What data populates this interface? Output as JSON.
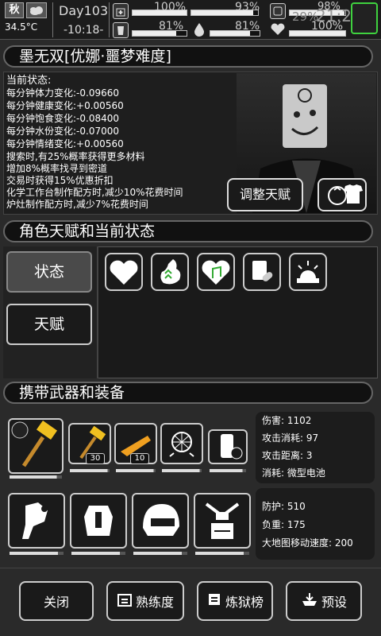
{
  "status_bar": {
    "season": "秋",
    "temperature": "34.5°C",
    "day": "Day103",
    "time": "-10:18-",
    "stats": [
      {
        "name": "stamina",
        "value": "100%",
        "level": 1.0
      },
      {
        "name": "mood",
        "value": "93%",
        "level": 0.93
      },
      {
        "name": "health",
        "value": "98%",
        "level": 0.98
      },
      {
        "name": "hunger",
        "value": "81%",
        "level": 0.81
      },
      {
        "name": "water",
        "value": "81%",
        "level": 0.81
      },
      {
        "name": "heart",
        "value": "100%",
        "level": 1.0
      }
    ],
    "battery": "29%",
    "clock": "21:21"
  },
  "character": {
    "name": "墨无双[优娜·噩梦难度]",
    "status_title": "当前状态:",
    "status_lines": [
      "每分钟体力变化:-0.09660",
      "每分钟健康变化:+0.00560",
      "每分钟饱食变化:-0.08400",
      "每分钟水份变化:-0.07000",
      "每分钟情绪变化:+0.00560",
      "搜索时,有25%概率获得更多材料",
      "增加8%概率找寻到密道",
      "交易时获得15%优惠折扣",
      "化学工作台制作配方时,减少10%花费时间",
      "炉灶制作配方时,减少7%花费时间"
    ],
    "adjust_talent_button": "调整天赋"
  },
  "talents": {
    "header": "角色天赋和当前状态",
    "tabs": [
      "状态",
      "天赋"
    ]
  },
  "equipment": {
    "header": "携带武器和装备",
    "weapon_slots": [
      {
        "name": "hammer-main",
        "count": "",
        "durability": 0.9
      },
      {
        "name": "hammer-2",
        "count": "30",
        "durability": 0.95
      },
      {
        "name": "rifle",
        "count": "10",
        "durability": 0.95
      },
      {
        "name": "disco-mine",
        "count": "",
        "durability": 0.95
      },
      {
        "name": "battery",
        "count": "",
        "durability": 0.9
      }
    ],
    "weapon_stats": [
      "伤害: 1102",
      "攻击消耗: 97",
      "攻击距离: 3",
      "消耗: 微型电池"
    ],
    "armor_slots": [
      {
        "name": "armor-1",
        "durability": 0.9
      },
      {
        "name": "armor-2",
        "durability": 0.9
      },
      {
        "name": "helmet",
        "durability": 0.9
      },
      {
        "name": "backpack",
        "durability": 0.9
      }
    ],
    "armor_stats": [
      "防护: 510",
      "负重: 175",
      "大地图移动速度: 200"
    ]
  },
  "bottom": {
    "close": "关闭",
    "proficiency": "熟练度",
    "ranking": "炼狱榜",
    "preset": "预设"
  },
  "colors": {
    "accent_green": "#3fd23f"
  }
}
